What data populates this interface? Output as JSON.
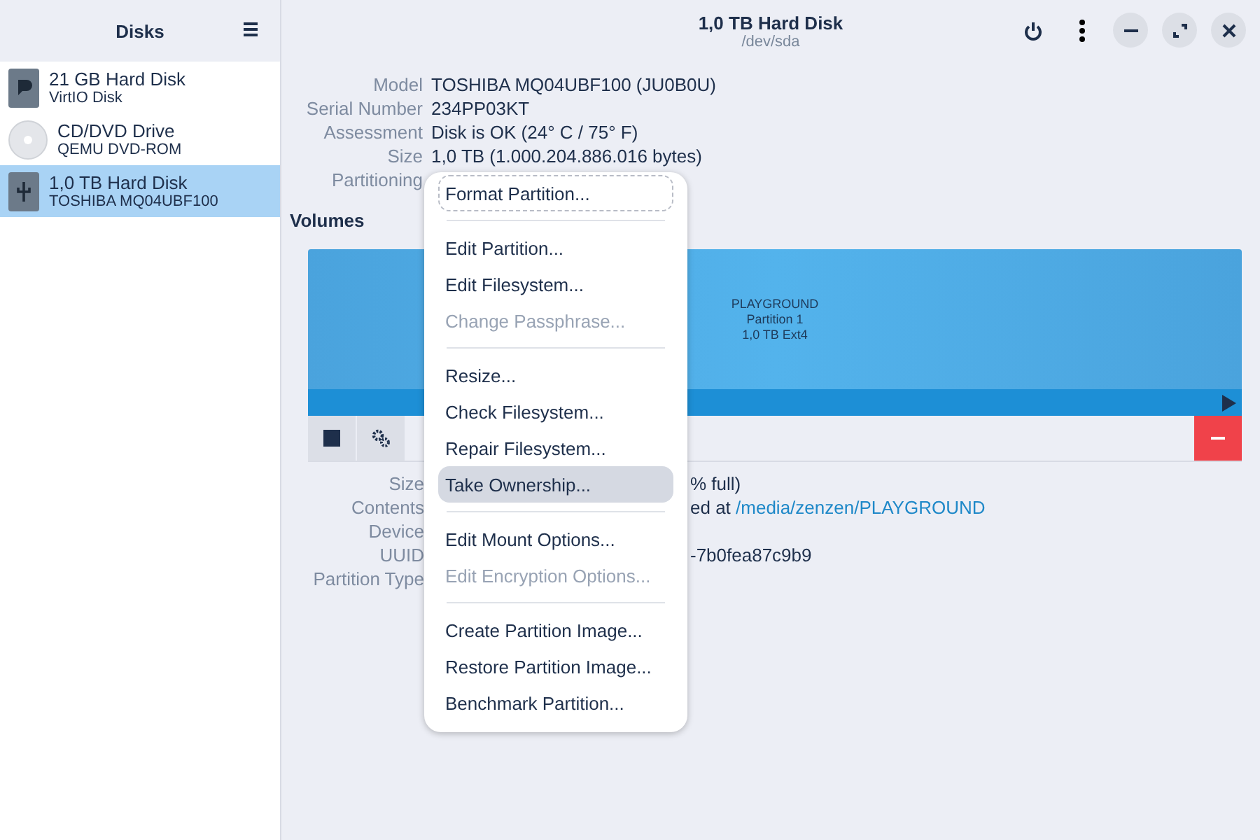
{
  "sidebar": {
    "title": "Disks",
    "disks": [
      {
        "name": "21 GB Hard Disk",
        "model": "VirtIO Disk",
        "kind": "hdd",
        "selected": false
      },
      {
        "name": "CD/DVD Drive",
        "model": "QEMU DVD-ROM",
        "kind": "optical",
        "selected": false
      },
      {
        "name": "1,0 TB Hard Disk",
        "model": "TOSHIBA MQ04UBF100",
        "kind": "usb",
        "selected": true
      }
    ]
  },
  "header": {
    "title": "1,0 TB Hard Disk",
    "subtitle": "/dev/sda"
  },
  "drive_info": [
    {
      "label": "Model",
      "value": "TOSHIBA MQ04UBF100 (JU0B0U)"
    },
    {
      "label": "Serial Number",
      "value": "234PP03KT"
    },
    {
      "label": "Assessment",
      "value": "Disk is OK (24° C / 75° F)"
    },
    {
      "label": "Size",
      "value": "1,0 TB (1.000.204.886.016 bytes)"
    },
    {
      "label": "Partitioning"
    }
  ],
  "volumes": {
    "title": "Volumes",
    "partition": {
      "name": "PLAYGROUND",
      "number": "Partition 1",
      "size": "1,0 TB Ext4"
    }
  },
  "volume_info": [
    {
      "label": "Size",
      "value": "% full)"
    },
    {
      "label": "Contents",
      "value": "ed at ",
      "link": "/media/zenzen/PLAYGROUND"
    },
    {
      "label": "Device"
    },
    {
      "label": "UUID",
      "value": "-7b0fea87c9b9"
    },
    {
      "label": "Partition Type"
    }
  ],
  "menu": [
    {
      "kind": "item",
      "label": "Format Partition...",
      "disabled": false,
      "focused": true,
      "selected": false
    },
    {
      "kind": "separator"
    },
    {
      "kind": "item",
      "label": "Edit Partition...",
      "disabled": false,
      "focused": false,
      "selected": false
    },
    {
      "kind": "item",
      "label": "Edit Filesystem...",
      "disabled": false,
      "focused": false,
      "selected": false
    },
    {
      "kind": "item",
      "label": "Change Passphrase...",
      "disabled": true,
      "focused": false,
      "selected": false
    },
    {
      "kind": "separator"
    },
    {
      "kind": "item",
      "label": "Resize...",
      "disabled": false,
      "focused": false,
      "selected": false
    },
    {
      "kind": "item",
      "label": "Check Filesystem...",
      "disabled": false,
      "focused": false,
      "selected": false
    },
    {
      "kind": "item",
      "label": "Repair Filesystem...",
      "disabled": false,
      "focused": false,
      "selected": false
    },
    {
      "kind": "item",
      "label": "Take Ownership...",
      "disabled": false,
      "focused": false,
      "selected": true
    },
    {
      "kind": "separator"
    },
    {
      "kind": "item",
      "label": "Edit Mount Options...",
      "disabled": false,
      "focused": false,
      "selected": false
    },
    {
      "kind": "item",
      "label": "Edit Encryption Options...",
      "disabled": true,
      "focused": false,
      "selected": false
    },
    {
      "kind": "separator"
    },
    {
      "kind": "item",
      "label": "Create Partition Image...",
      "disabled": false,
      "focused": false,
      "selected": false
    },
    {
      "kind": "item",
      "label": "Restore Partition Image...",
      "disabled": false,
      "focused": false,
      "selected": false
    },
    {
      "kind": "item",
      "label": "Benchmark Partition...",
      "disabled": false,
      "focused": false,
      "selected": false
    }
  ]
}
